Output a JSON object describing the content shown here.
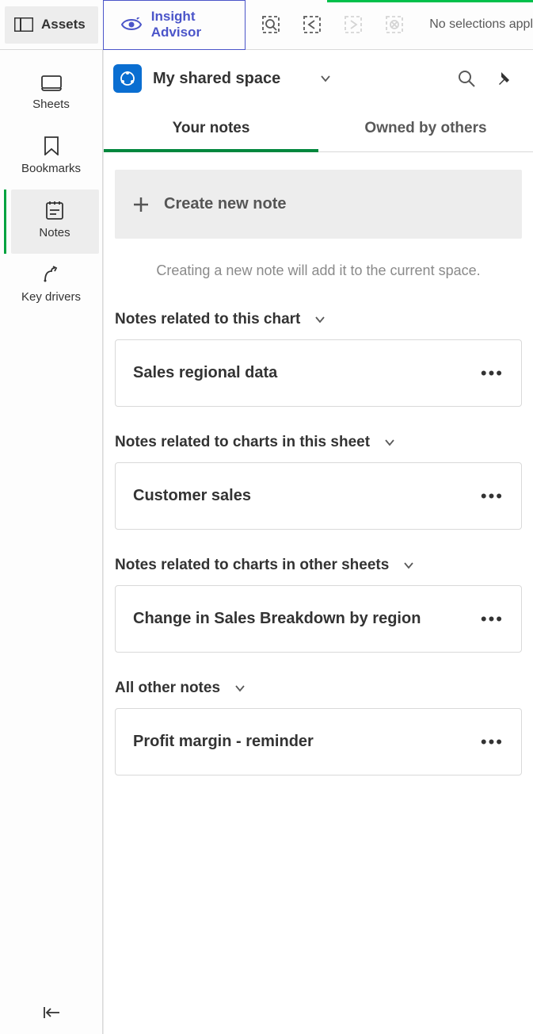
{
  "topbar": {
    "assets_label": "Assets",
    "insight_label": "Insight Advisor",
    "selections_text": "No selections appl"
  },
  "sidebar": {
    "items": [
      {
        "label": "Sheets"
      },
      {
        "label": "Bookmarks"
      },
      {
        "label": "Notes"
      },
      {
        "label": "Key drivers"
      }
    ]
  },
  "space": {
    "title": "My shared space"
  },
  "tabs": {
    "your_notes": "Your notes",
    "owned_by_others": "Owned by others"
  },
  "create": {
    "label": "Create new note",
    "hint": "Creating a new note will add it to the current space."
  },
  "sections": [
    {
      "header": "Notes related to this chart",
      "notes": [
        "Sales regional data"
      ]
    },
    {
      "header": "Notes related to charts in this sheet",
      "notes": [
        "Customer sales"
      ]
    },
    {
      "header": "Notes related to charts in other sheets",
      "notes": [
        "Change in Sales Breakdown by region"
      ]
    },
    {
      "header": "All other notes",
      "notes": [
        "Profit margin - reminder"
      ]
    }
  ]
}
